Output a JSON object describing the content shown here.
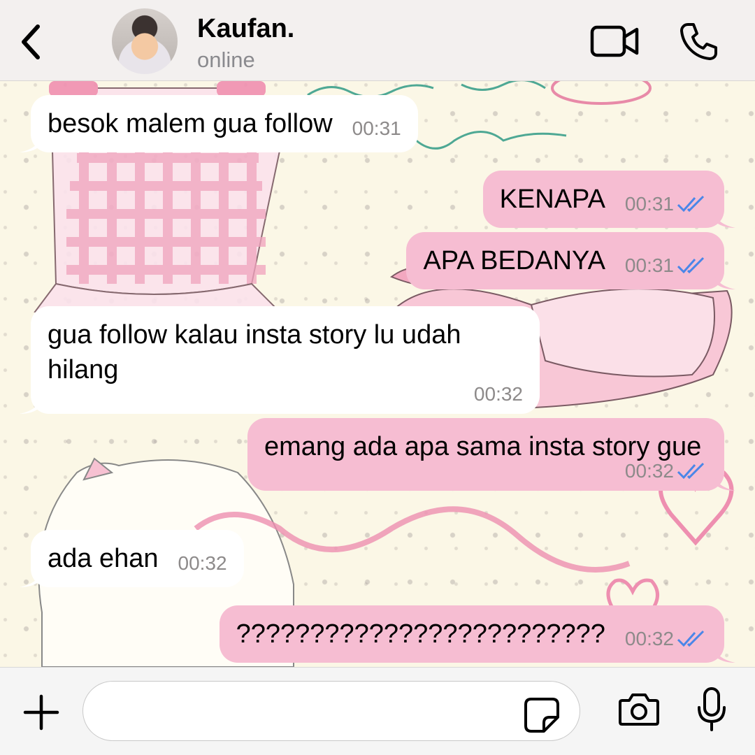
{
  "header": {
    "contact_name": "Kaufan.",
    "status": "online"
  },
  "icons": {
    "back": "chevron-left-icon",
    "video": "video-camera-icon",
    "call": "phone-icon",
    "add": "plus-icon",
    "sticker": "sticker-icon",
    "camera": "camera-icon",
    "mic": "microphone-icon",
    "read_receipt": "double-check-icon"
  },
  "colors": {
    "outgoing_bubble": "#f6bdd2",
    "incoming_bubble": "#ffffff",
    "read_ticks": "#4a86e8",
    "timestamp": "#8d8a8a"
  },
  "messages": [
    {
      "direction": "in",
      "text": "besok malem gua follow",
      "time": "00:31"
    },
    {
      "direction": "out",
      "text": "KENAPA",
      "time": "00:31",
      "read": true
    },
    {
      "direction": "out",
      "text": "APA BEDANYA",
      "time": "00:31",
      "read": true
    },
    {
      "direction": "in",
      "text": "gua follow kalau insta story lu udah hilang",
      "time": "00:32"
    },
    {
      "direction": "out",
      "text": "emang ada apa sama insta story gue",
      "time": "00:32",
      "read": true
    },
    {
      "direction": "in",
      "text": "ada ehan",
      "time": "00:32"
    },
    {
      "direction": "out",
      "text": "?????????????????????????",
      "time": "00:32",
      "read": true
    }
  ],
  "composer": {
    "placeholder": "",
    "value": ""
  }
}
